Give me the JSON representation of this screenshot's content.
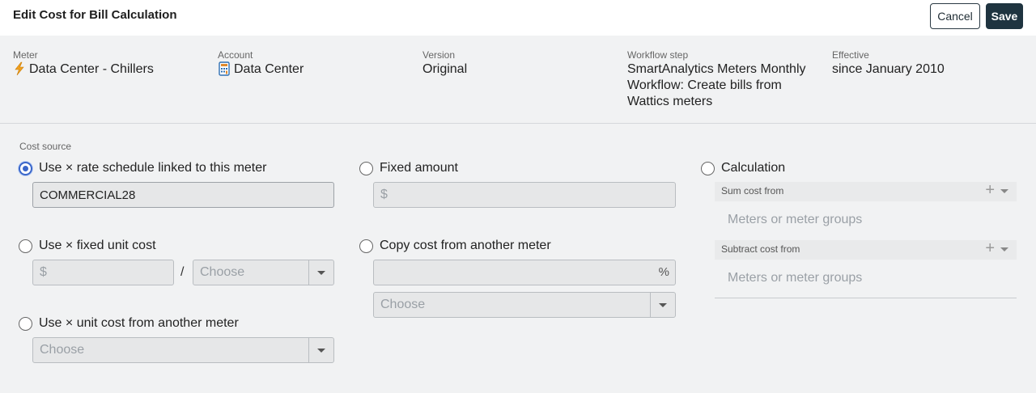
{
  "header": {
    "title": "Edit Cost for Bill Calculation",
    "cancel_label": "Cancel",
    "save_label": "Save"
  },
  "info": {
    "meter": {
      "label": "Meter",
      "value": "Data Center - Chillers",
      "icon": "lightning-meter-icon"
    },
    "account": {
      "label": "Account",
      "value": "Data Center",
      "icon": "calculator-icon"
    },
    "version": {
      "label": "Version",
      "value": "Original"
    },
    "workflow": {
      "label": "Workflow step",
      "value": "SmartAnalytics Meters Monthly Workflow: Create bills from Wattics meters"
    },
    "effective": {
      "label": "Effective",
      "value": "since January 2010"
    }
  },
  "cost_source": {
    "label": "Cost source",
    "selected": "rate_schedule",
    "rate_schedule": {
      "label": "Use × rate schedule linked to this meter",
      "value": "COMMERCIAL28"
    },
    "fixed_unit_cost": {
      "label": "Use × fixed unit cost",
      "placeholder": "$",
      "slash": "/",
      "unit_placeholder": "Choose"
    },
    "unit_cost_other": {
      "label": "Use × unit cost from another meter",
      "placeholder": "Choose"
    },
    "fixed_amount": {
      "label": "Fixed amount",
      "placeholder": "$"
    },
    "copy_cost": {
      "label": "Copy cost from another meter",
      "suffix": "%",
      "placeholder": "Choose"
    },
    "calculation": {
      "label": "Calculation",
      "sum_label": "Sum cost from",
      "sum_placeholder": "Meters or meter groups",
      "subtract_label": "Subtract cost from",
      "subtract_placeholder": "Meters or meter groups",
      "plus_symbol": "+"
    }
  },
  "colors": {
    "accent": "#3a66c9",
    "save_bg": "#1f3440",
    "meter_icon": "#f0a020"
  }
}
